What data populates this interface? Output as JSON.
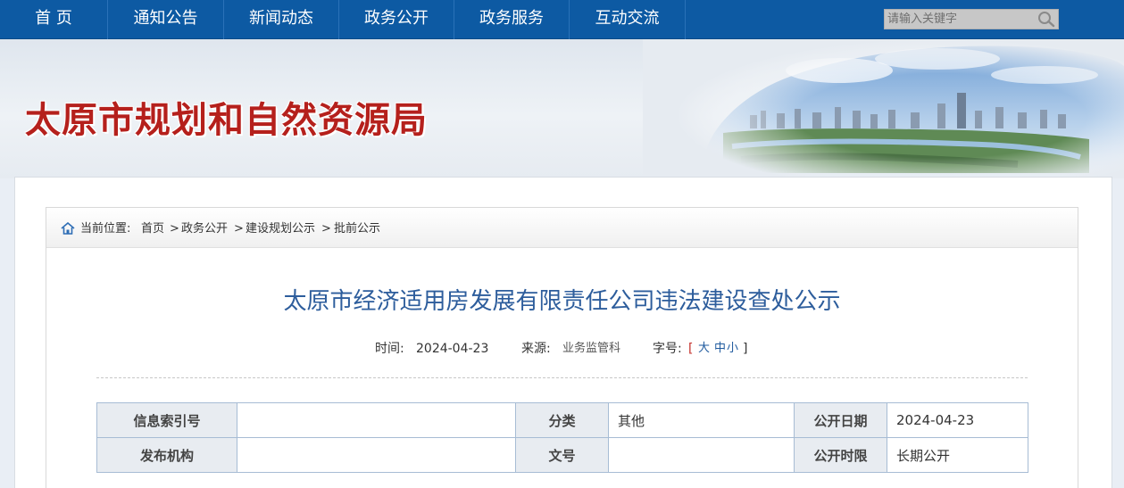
{
  "nav": {
    "items": [
      "首  页",
      "通知公告",
      "新闻动态",
      "政务公开",
      "政务服务",
      "互动交流"
    ],
    "search_placeholder": "请输入关键字"
  },
  "banner": {
    "title": "太原市规划和自然资源局"
  },
  "breadcrumb": {
    "prefix": "当前位置:",
    "items": [
      "首页",
      "政务公开",
      "建设规划公示",
      "批前公示"
    ],
    "separator": ">"
  },
  "article": {
    "title": "太原市经济适用房发展有限责任公司违法建设查处公示",
    "time_label": "时间:",
    "time_value": "2024-04-23",
    "source_label": "来源:",
    "source_value": "业务监管科",
    "fontsize_label": "字号:",
    "fontsize_open": "[",
    "fontsize_large": "大",
    "fontsize_medium": "中",
    "fontsize_small": "小",
    "fontsize_close": "]"
  },
  "info_table": {
    "rows": [
      [
        "信息索引号",
        "",
        "分类",
        "其他",
        "公开日期",
        "2024-04-23"
      ],
      [
        "发布机构",
        "",
        "文号",
        "",
        "公开时限",
        "长期公开"
      ]
    ]
  },
  "colors": {
    "nav_bg": "#0d5aa3",
    "title_red": "#b5201c",
    "article_title_blue": "#2d5d9c"
  }
}
